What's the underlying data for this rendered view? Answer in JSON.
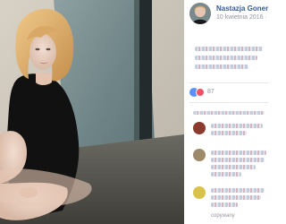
{
  "post": {
    "author_name": "Nastazja Gonera",
    "date": "10 kwietnia 2016",
    "date_separator": "·"
  },
  "reactions": {
    "count": "87"
  },
  "comments": {
    "footer_text": "copywany"
  },
  "icons": {
    "privacy": "globe-icon",
    "reactions": [
      "like-icon",
      "love-icon"
    ]
  },
  "colors": {
    "link": "#365899",
    "meta": "#90949c",
    "like": "#5890ff",
    "love": "#f25268"
  }
}
